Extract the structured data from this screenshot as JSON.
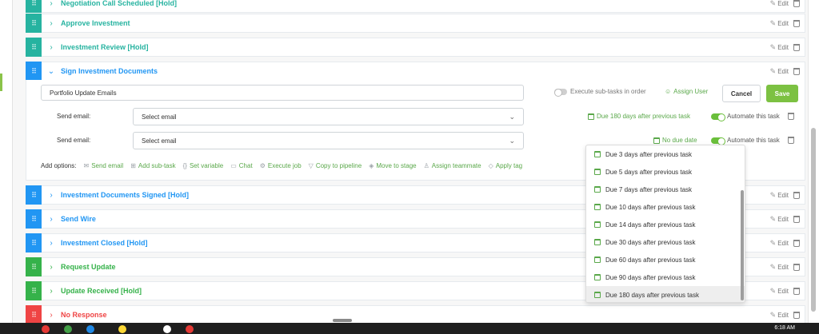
{
  "tasks_above": [
    {
      "title": "Negotiation Call Scheduled [Hold]",
      "color": "teal"
    },
    {
      "title": "Approve Investment",
      "color": "teal"
    },
    {
      "title": "Investment Review [Hold]",
      "color": "teal"
    }
  ],
  "expanded_task": {
    "title": "Sign Investment Documents",
    "color": "blue",
    "subtask_value": "Portfolio Update Emails",
    "execute_label": "Execute sub-tasks in order",
    "assign_user": "Assign User",
    "cancel": "Cancel",
    "save": "Save",
    "email_rows": [
      {
        "label": "Send email:",
        "placeholder": "Select email",
        "due": "Due 180 days after previous task",
        "automate": "Automate this task"
      },
      {
        "label": "Send email:",
        "placeholder": "Select email",
        "due": "No due date",
        "automate": "Automate this task"
      }
    ],
    "add_options_label": "Add options:",
    "add_options": [
      "Send email",
      "Add sub-task",
      "Set variable",
      "Chat",
      "Execute job",
      "Copy to pipeline",
      "Move to stage",
      "Assign teammate",
      "Apply tag"
    ]
  },
  "tasks_below": [
    {
      "title": "Investment Documents Signed [Hold]",
      "color": "blue"
    },
    {
      "title": "Send Wire",
      "color": "blue"
    },
    {
      "title": "Investment Closed [Hold]",
      "color": "blue"
    },
    {
      "title": "Request Update",
      "color": "green"
    },
    {
      "title": "Update Received [Hold]",
      "color": "green"
    },
    {
      "title": "No Response",
      "color": "red"
    }
  ],
  "edit_label": "Edit",
  "due_dropdown": {
    "options": [
      "Due 3 days after previous task",
      "Due 5 days after previous task",
      "Due 7 days after previous task",
      "Due 10 days after previous task",
      "Due 14 days after previous task",
      "Due 30 days after previous task",
      "Due 60 days after previous task",
      "Due 90 days after previous task",
      "Due 180 days after previous task"
    ],
    "selected": "Due 180 days after previous task"
  },
  "taskbar": {
    "time": "6:18 AM"
  },
  "colors": {
    "teal": "#26b3a0",
    "blue": "#2196f3",
    "green": "#35b24a",
    "red": "#ef4444",
    "save": "#7cc142"
  }
}
